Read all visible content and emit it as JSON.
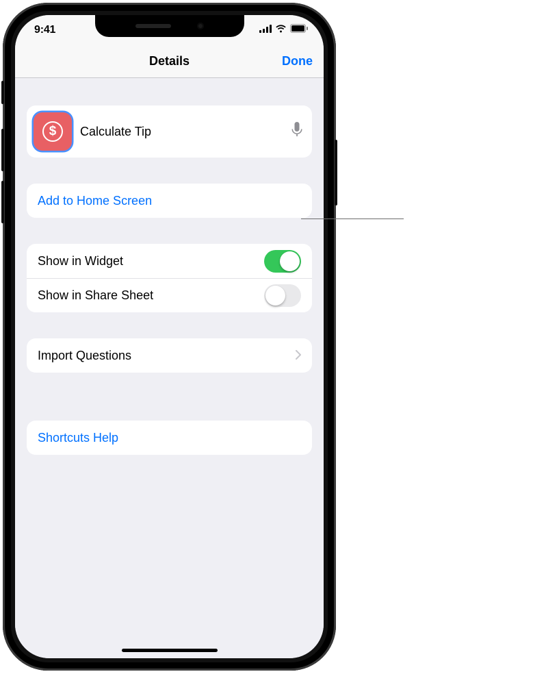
{
  "status": {
    "time": "9:41"
  },
  "nav": {
    "title": "Details",
    "done": "Done"
  },
  "shortcut": {
    "name": "Calculate Tip",
    "icon_glyph": "$",
    "icon_color": "#e86064"
  },
  "actions": {
    "add_to_home": "Add to Home Screen"
  },
  "toggles": {
    "show_widget": {
      "label": "Show in Widget",
      "on": true
    },
    "show_share": {
      "label": "Show in Share Sheet",
      "on": false
    }
  },
  "import": {
    "label": "Import Questions"
  },
  "help": {
    "label": "Shortcuts Help"
  }
}
